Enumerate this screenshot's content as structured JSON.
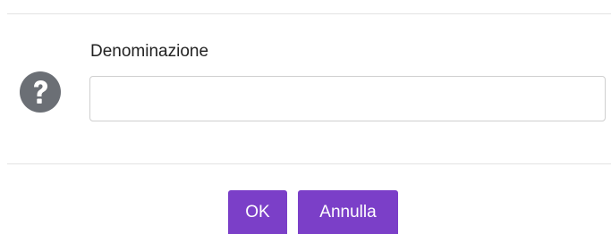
{
  "dialog": {
    "field_label": "Denominazione",
    "field_value": "",
    "icon": "question-icon",
    "ok_label": "OK",
    "cancel_label": "Annulla",
    "colors": {
      "button_bg": "#7b3fc8",
      "button_text": "#ffffff",
      "icon_bg": "#6b6f75"
    }
  }
}
